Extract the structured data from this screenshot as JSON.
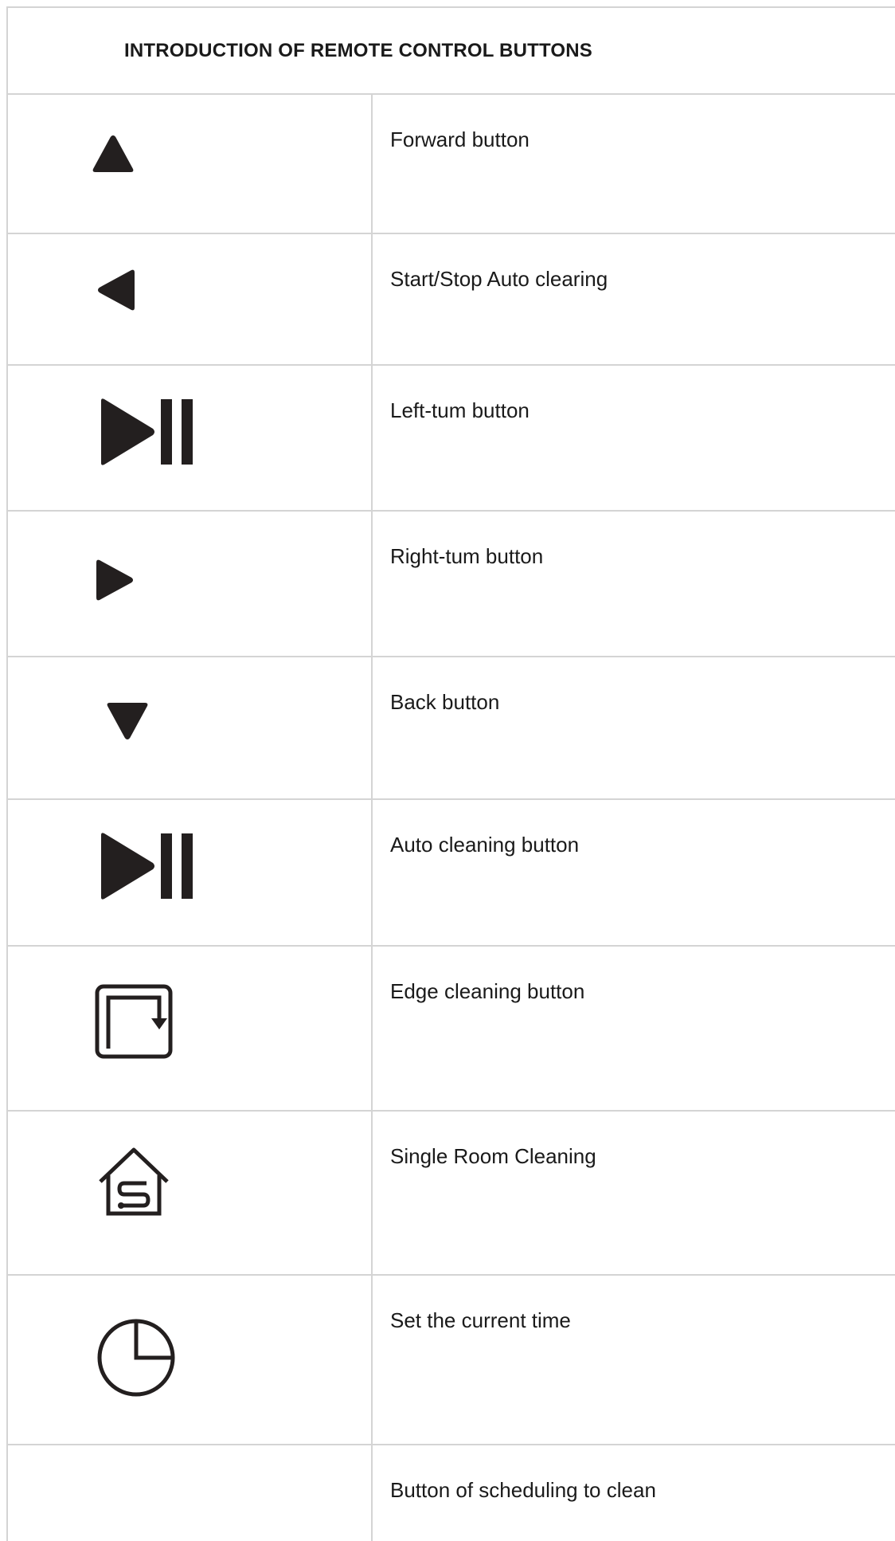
{
  "title": "INTRODUCTION OF REMOTE CONTROL BUTTONS",
  "rows": [
    {
      "icon": "triangle-up-icon",
      "label": "Forward button"
    },
    {
      "icon": "triangle-left-icon",
      "label": "Start/Stop Auto clearing"
    },
    {
      "icon": "play-pause-icon",
      "label": "Left-tum button"
    },
    {
      "icon": "triangle-right-icon",
      "label": "Right-tum button"
    },
    {
      "icon": "triangle-down-icon",
      "label": "Back button"
    },
    {
      "icon": "play-pause-icon",
      "label": "Auto cleaning button"
    },
    {
      "icon": "edge-cleaning-icon",
      "label": "Edge cleaning button"
    },
    {
      "icon": "house-s-icon",
      "label": "Single Room Cleaning"
    },
    {
      "icon": "clock-icon",
      "label": "Set the current time"
    },
    {
      "icon": "",
      "label": "Button of scheduling to clean"
    }
  ]
}
